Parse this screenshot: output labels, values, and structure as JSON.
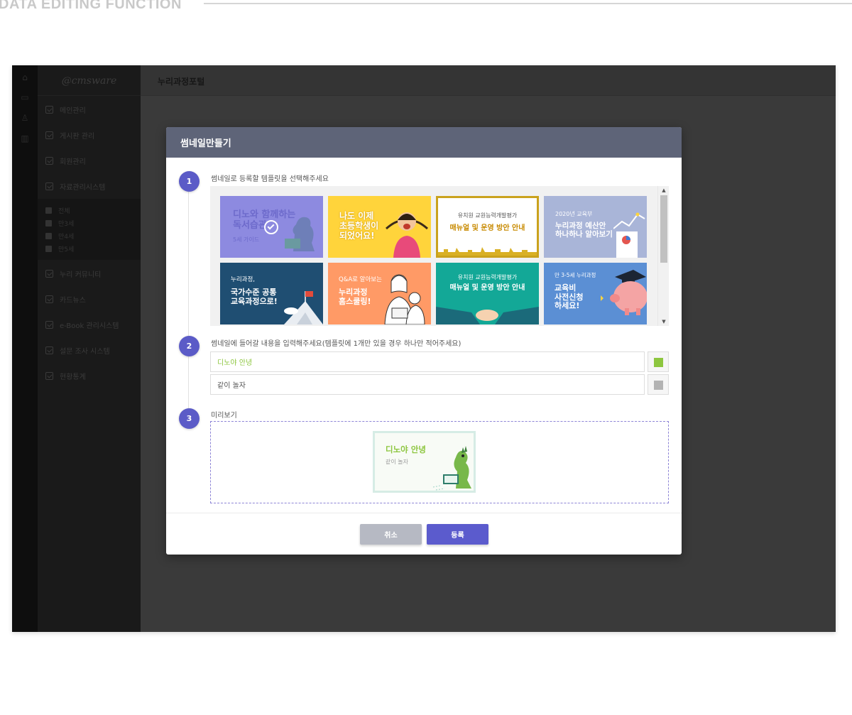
{
  "section": {
    "title": "DATA EDITING FUNCTION"
  },
  "app": {
    "logo": "@cmsware",
    "page_title": "누리과정포털",
    "iconbar": [
      {
        "icon": "home-icon",
        "glyph": "⌂"
      },
      {
        "icon": "folder-icon",
        "glyph": "▭"
      },
      {
        "icon": "user-icon",
        "glyph": "♙"
      },
      {
        "icon": "chart-icon",
        "glyph": "▥"
      }
    ],
    "nav": [
      {
        "label": "메인관리"
      },
      {
        "label": "게시판 관리"
      },
      {
        "label": "회원관리"
      },
      {
        "label": "자료관리시스템"
      }
    ],
    "subnav": [
      {
        "label": "전체"
      },
      {
        "label": "만3세"
      },
      {
        "label": "만4세"
      },
      {
        "label": "만5세"
      }
    ],
    "nav_bottom": [
      {
        "label": "누리 커뮤니티"
      },
      {
        "label": "카드뉴스"
      },
      {
        "label": "e-Book 관리시스템"
      },
      {
        "label": "설문 조사 시스템"
      },
      {
        "label": "현황통계"
      }
    ]
  },
  "modal": {
    "title": "썸네일만들기",
    "step1": {
      "number": "1",
      "label": "썸네일로 등록할 템플릿을 선택해주세요"
    },
    "step2": {
      "number": "2",
      "label": "썸네일에 들어갈 내용을 입력해주세요(템플릿에 1개만 있을 경우 하나만 적어주세요)"
    },
    "step3": {
      "number": "3",
      "label": "미리보기"
    },
    "templates": [
      {
        "title": "디노와 함께하는\n독서습관",
        "sub": "5세 가이드",
        "bg": "#8d8ae0",
        "selected": true
      },
      {
        "title": "나도 이제\n초등학생이\n되었어요!",
        "bg": "#ffd43b",
        "selected": false
      },
      {
        "title": "매뉴얼 및 운영 방안 안내",
        "sub": "유치원 교원능력개발평가",
        "bg": "#ffffff",
        "border": "#caa21d",
        "selected": false
      },
      {
        "title": "누리과정 예산안\n하나하나 알아보기",
        "sub": "2020년 교육부",
        "bg": "#a9b5d8",
        "selected": false
      },
      {
        "title": "국가수준 공통\n교육과정으로!",
        "sub": "누리과정,",
        "bg": "#1f4e72",
        "selected": false
      },
      {
        "title": "누리과정\n홈스쿨링!",
        "sub": "Q&A로 알아보는",
        "bg": "#ff9a66",
        "selected": false
      },
      {
        "title": "매뉴얼 및 운영 방안 안내",
        "sub": "유치원 교원능력개발평가",
        "bg": "#13a897",
        "selected": false
      },
      {
        "title": "교육비\n사전신청\n하세요!",
        "sub": "만 3-5세 누리과정",
        "bg": "#5b8fd4",
        "selected": false
      }
    ],
    "inputs": [
      {
        "value": "디노야 안녕",
        "color": "#8dc63f"
      },
      {
        "value": "같이 놀자",
        "color": "#b3b3b3"
      }
    ],
    "preview": {
      "line1": "디노야 안녕",
      "line2": "같이 놀자"
    },
    "buttons": {
      "cancel": "취소",
      "submit": "등록"
    },
    "scroll": {
      "up": "▲",
      "down": "▼"
    }
  }
}
